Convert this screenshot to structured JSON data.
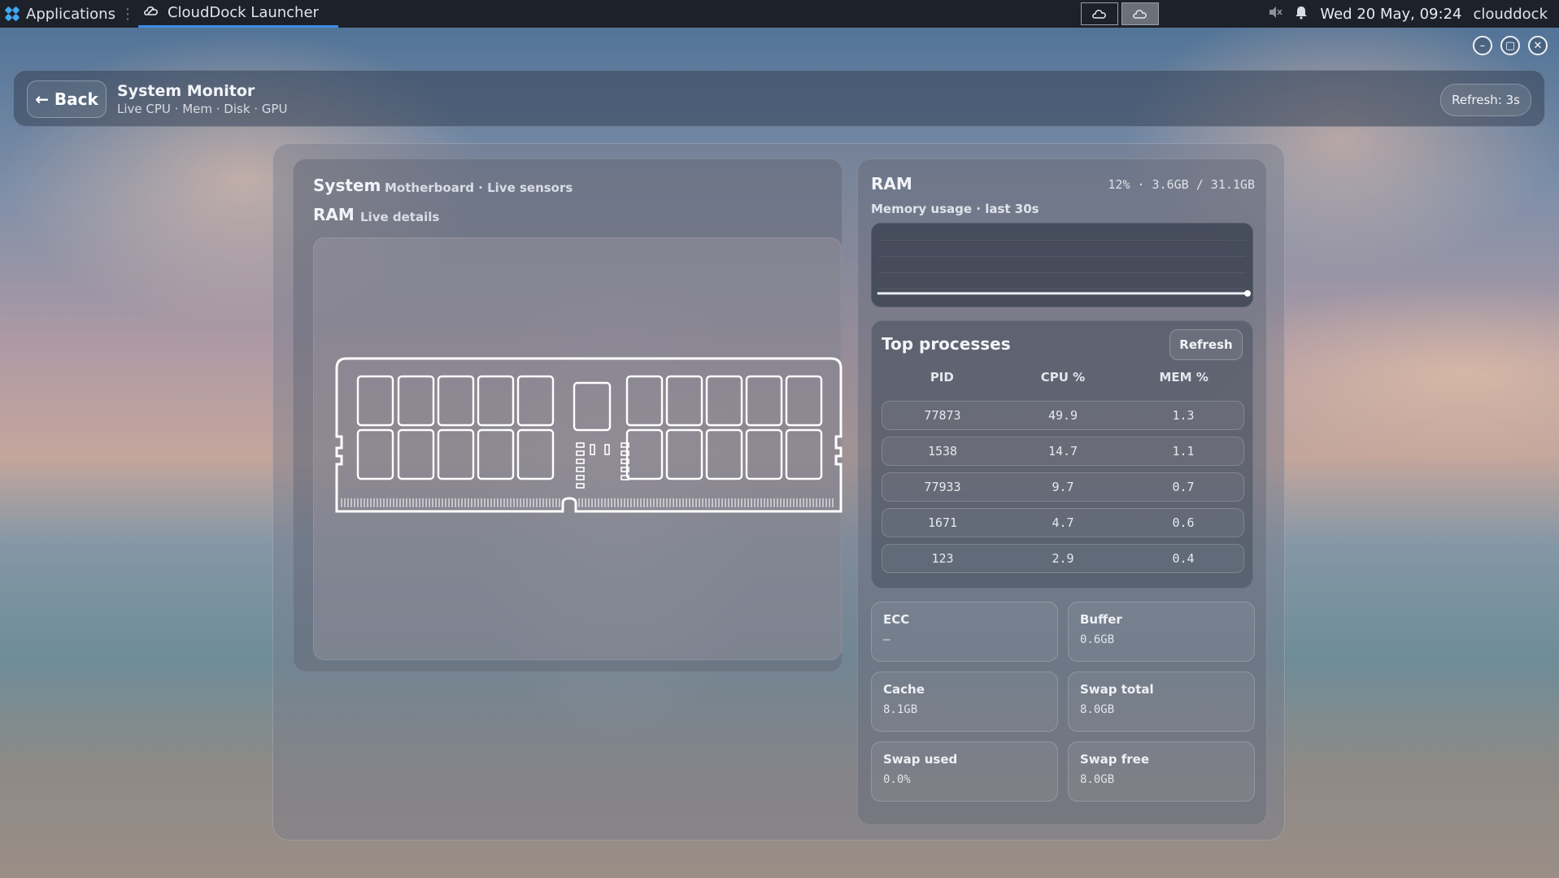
{
  "taskbar": {
    "apps_label": "Applications",
    "task_label": "CloudDock Launcher",
    "clock": "Wed 20 May, 09:24",
    "user": "clouddock"
  },
  "header": {
    "back_label": "← Back",
    "title": "System Monitor",
    "subtitle": "Live CPU · Mem · Disk · GPU",
    "refresh_label": "Refresh: 3s"
  },
  "left": {
    "title": "System",
    "subtitle": "Motherboard · Live sensors",
    "section_title": "RAM",
    "section_subtitle": "Live details"
  },
  "ram": {
    "title": "RAM",
    "stats": "12% · 3.6GB / 31.1GB",
    "graph_label": "Memory usage · last 30s",
    "usage_percent": 12
  },
  "processes": {
    "title": "Top processes",
    "refresh_label": "Refresh",
    "columns": [
      "PID",
      "CPU %",
      "MEM %"
    ],
    "rows": [
      {
        "pid": "77873",
        "cpu": "49.9",
        "mem": "1.3"
      },
      {
        "pid": "1538",
        "cpu": "14.7",
        "mem": "1.1"
      },
      {
        "pid": "77933",
        "cpu": "9.7",
        "mem": "0.7"
      },
      {
        "pid": "1671",
        "cpu": "4.7",
        "mem": "0.6"
      },
      {
        "pid": "123",
        "cpu": "2.9",
        "mem": "0.4"
      }
    ]
  },
  "stats": [
    {
      "label": "ECC",
      "value": "–"
    },
    {
      "label": "Buffer",
      "value": "0.6GB"
    },
    {
      "label": "Cache",
      "value": "8.1GB"
    },
    {
      "label": "Swap total",
      "value": "8.0GB"
    },
    {
      "label": "Swap used",
      "value": "0.0%"
    },
    {
      "label": "Swap free",
      "value": "8.0GB"
    }
  ]
}
